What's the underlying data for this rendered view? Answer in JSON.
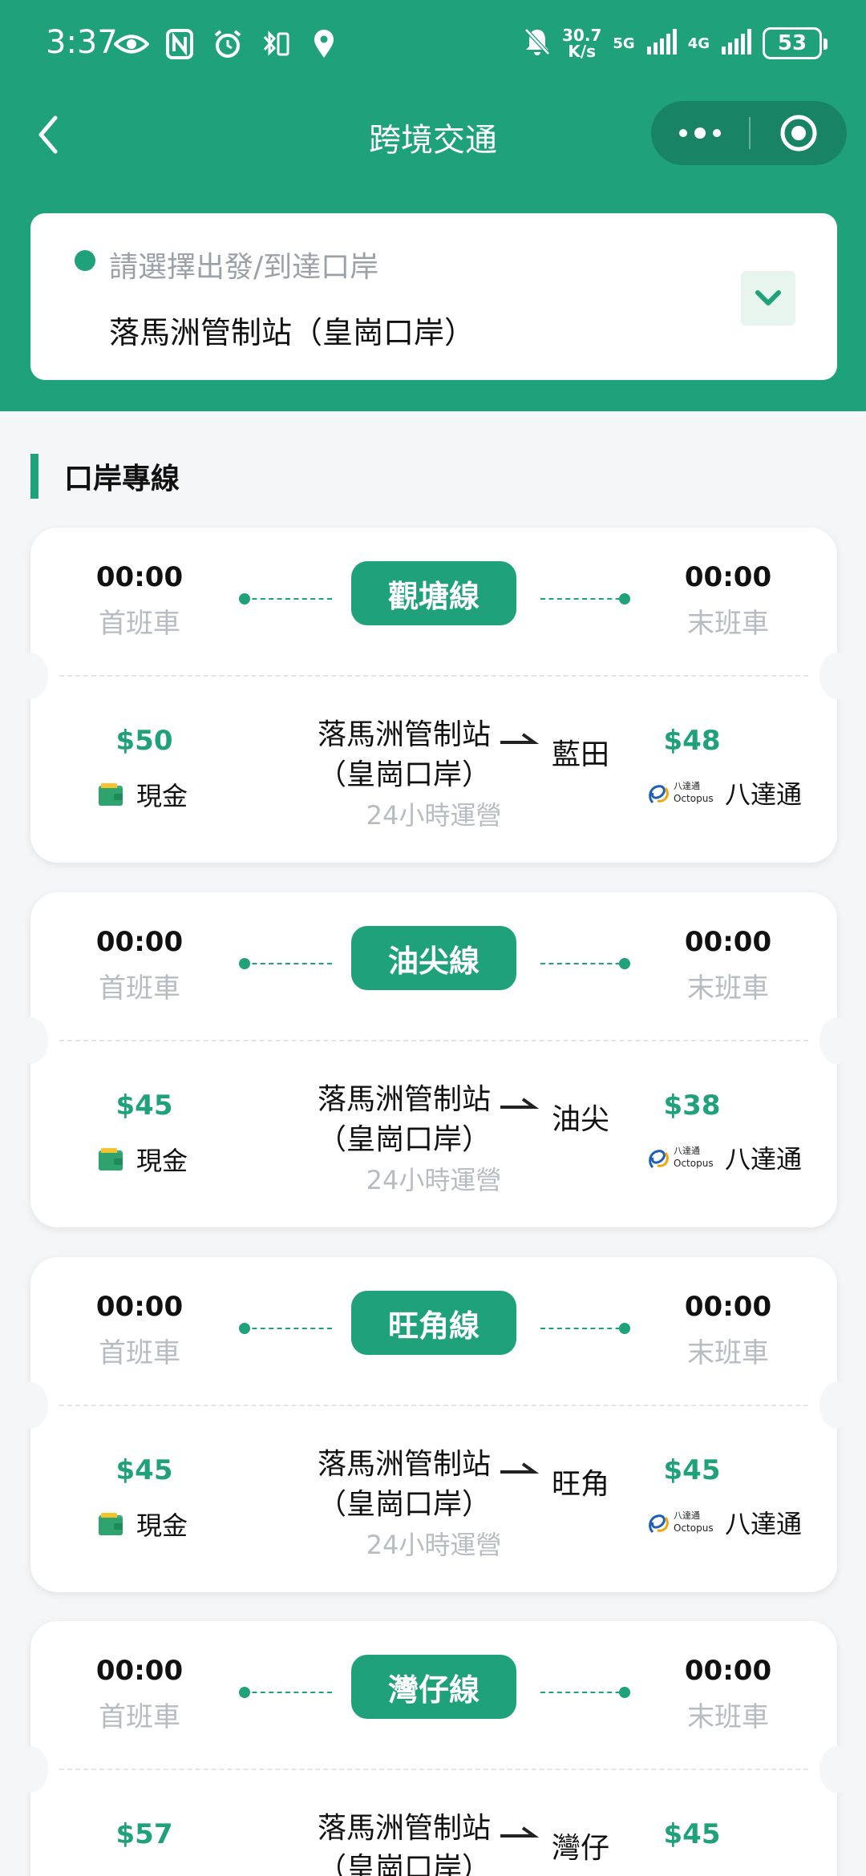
{
  "status_bar": {
    "time": "3:37",
    "speed_value": "30.7",
    "speed_unit": "K/s",
    "net1": "5G",
    "net2": "4G",
    "battery": "53"
  },
  "nav": {
    "title": "跨境交通"
  },
  "selector": {
    "hint": "請選擇出發/到達口岸",
    "value": "落馬洲管制站（皇崗口岸）"
  },
  "section": {
    "title": "口岸專線"
  },
  "routes": [
    {
      "name": "觀塘線",
      "first_time": "00:00",
      "first_label": "首班車",
      "last_time": "00:00",
      "last_label": "末班車",
      "cash_price": "$50",
      "cash_label": "現金",
      "from_line1": "落馬洲管制站",
      "from_line2": "（皇崗口岸）",
      "to": "藍田",
      "octopus_price": "$48",
      "octopus_label": "八達通",
      "hours": "24小時運營"
    },
    {
      "name": "油尖線",
      "first_time": "00:00",
      "first_label": "首班車",
      "last_time": "00:00",
      "last_label": "末班車",
      "cash_price": "$45",
      "cash_label": "現金",
      "from_line1": "落馬洲管制站",
      "from_line2": "（皇崗口岸）",
      "to": "油尖",
      "octopus_price": "$38",
      "octopus_label": "八達通",
      "hours": "24小時運營"
    },
    {
      "name": "旺角線",
      "first_time": "00:00",
      "first_label": "首班車",
      "last_time": "00:00",
      "last_label": "末班車",
      "cash_price": "$45",
      "cash_label": "現金",
      "from_line1": "落馬洲管制站",
      "from_line2": "（皇崗口岸）",
      "to": "旺角",
      "octopus_price": "$45",
      "octopus_label": "八達通",
      "hours": "24小時運營"
    },
    {
      "name": "灣仔線",
      "first_time": "00:00",
      "first_label": "首班車",
      "last_time": "00:00",
      "last_label": "末班車",
      "cash_price": "$57",
      "from_line1": "落馬洲管制站",
      "from_line2": "（皇崗口岸）",
      "to": "灣仔",
      "octopus_price": "$45"
    }
  ],
  "octopus_logo_text": "八達通 Octopus",
  "colors": {
    "brand": "#1fa17a",
    "muted": "#b6bcc1",
    "background": "#f5f6f7"
  }
}
